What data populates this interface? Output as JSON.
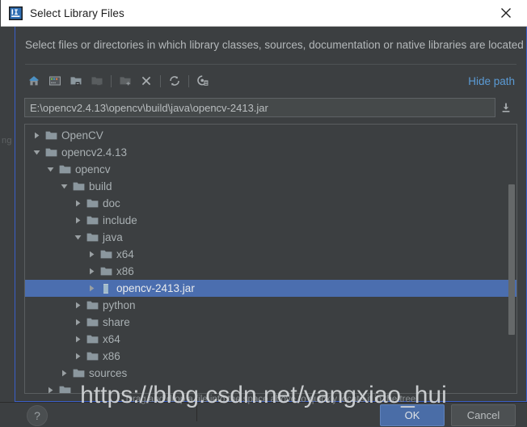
{
  "window": {
    "title": "Select Library Files",
    "icon": "intellij-idea-icon",
    "close_label": "✕"
  },
  "dialog": {
    "subtitle": "Select files or directories in which library classes, sources, documentation or native libraries are located",
    "hint": "Drag and drop a file into the space above to quickly locate it in the tree"
  },
  "toolbar": {
    "buttons": [
      {
        "name": "home-icon",
        "tooltip": "Home"
      },
      {
        "name": "desktop-icon",
        "tooltip": "Desktop"
      },
      {
        "name": "project-folder-icon",
        "tooltip": "Project Directory"
      },
      {
        "name": "module-folder-icon",
        "tooltip": "Module Directory"
      },
      {
        "name": "new-folder-icon",
        "tooltip": "New Folder"
      },
      {
        "name": "delete-icon",
        "tooltip": "Delete"
      },
      {
        "name": "refresh-icon",
        "tooltip": "Refresh"
      },
      {
        "name": "show-hidden-icon",
        "tooltip": "Show Hidden Files and Directories"
      }
    ],
    "hide_path_label": "Hide path"
  },
  "path": {
    "value": "E:\\opencv2.4.13\\opencv\\build\\java\\opencv-2413.jar",
    "placeholder": "",
    "download_icon": "download-icon"
  },
  "tree": {
    "rows": [
      {
        "label": "OpenCV",
        "depth": 1,
        "twist": "collapsed",
        "icon": "folder-icon",
        "selected": false
      },
      {
        "label": "opencv2.4.13",
        "depth": 1,
        "twist": "expanded",
        "icon": "folder-icon",
        "selected": false
      },
      {
        "label": "opencv",
        "depth": 2,
        "twist": "expanded",
        "icon": "folder-icon",
        "selected": false
      },
      {
        "label": "build",
        "depth": 3,
        "twist": "expanded",
        "icon": "folder-icon",
        "selected": false
      },
      {
        "label": "doc",
        "depth": 4,
        "twist": "collapsed",
        "icon": "folder-icon",
        "selected": false
      },
      {
        "label": "include",
        "depth": 4,
        "twist": "collapsed",
        "icon": "folder-icon",
        "selected": false
      },
      {
        "label": "java",
        "depth": 4,
        "twist": "expanded",
        "icon": "folder-icon",
        "selected": false
      },
      {
        "label": "x64",
        "depth": 5,
        "twist": "collapsed",
        "icon": "folder-icon",
        "selected": false
      },
      {
        "label": "x86",
        "depth": 5,
        "twist": "collapsed",
        "icon": "folder-icon",
        "selected": false
      },
      {
        "label": "opencv-2413.jar",
        "depth": 5,
        "twist": "collapsed",
        "icon": "jar-icon",
        "selected": true
      },
      {
        "label": "python",
        "depth": 4,
        "twist": "collapsed",
        "icon": "folder-icon",
        "selected": false
      },
      {
        "label": "share",
        "depth": 4,
        "twist": "collapsed",
        "icon": "folder-icon",
        "selected": false
      },
      {
        "label": "x64",
        "depth": 4,
        "twist": "collapsed",
        "icon": "folder-icon",
        "selected": false
      },
      {
        "label": "x86",
        "depth": 4,
        "twist": "collapsed",
        "icon": "folder-icon",
        "selected": false
      },
      {
        "label": "sources",
        "depth": 3,
        "twist": "collapsed",
        "icon": "folder-icon",
        "selected": false
      },
      {
        "label": "",
        "depth": 2,
        "twist": "collapsed",
        "icon": "folder-icon",
        "selected": false
      }
    ],
    "scrollbar": {
      "thumb_top_pct": 22,
      "thumb_height_pct": 56
    }
  },
  "footer": {
    "help_label": "?",
    "ok_label": "OK",
    "cancel_label": "Cancel"
  },
  "watermark": {
    "text": "https://blog.csdn.net/yangxiao_hui"
  },
  "backdrop": {
    "ghost_text": "ng"
  },
  "colors": {
    "dialog_bg": "#3c3f41",
    "titlebar_bg": "#ffffff",
    "selection_blue": "#4b6eaf",
    "link_blue": "#5b9bd5",
    "ok_button": "#4a6da7",
    "border_blue": "#3a5fc8",
    "text": "#a9b0b3"
  }
}
